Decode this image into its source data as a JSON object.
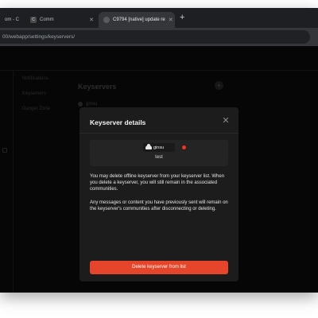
{
  "browser": {
    "tabs": [
      {
        "label": "om - C",
        "favicon": ""
      },
      {
        "label": "Comm",
        "favicon": "C"
      },
      {
        "label": "C9794 [native] update re",
        "favicon": ""
      }
    ],
    "new_tab": "+",
    "url": "00/webapp/settings/keyservers/"
  },
  "app": {
    "nav": [
      "Notifications",
      "Keyservers",
      "Danger Zone"
    ],
    "section_title": "Keyservers",
    "add_symbol": "+",
    "row_name": "ginsu"
  },
  "modal": {
    "title": "Keyserver details",
    "close": "✕",
    "keyserver_name": "ginsu",
    "keyserver_url": "test",
    "paragraph_1": "You may delete offline keyserver from your keyserver list. When you delete a keyserver, you will still remain in the associated communities.",
    "paragraph_2": "Any messages or content you have previously sent will remain on the keyserver's communities after disconnecting or deleting.",
    "delete_label": "Delete keyserver from list",
    "status_color": "#e23b2a",
    "accent": "#e5462b"
  }
}
